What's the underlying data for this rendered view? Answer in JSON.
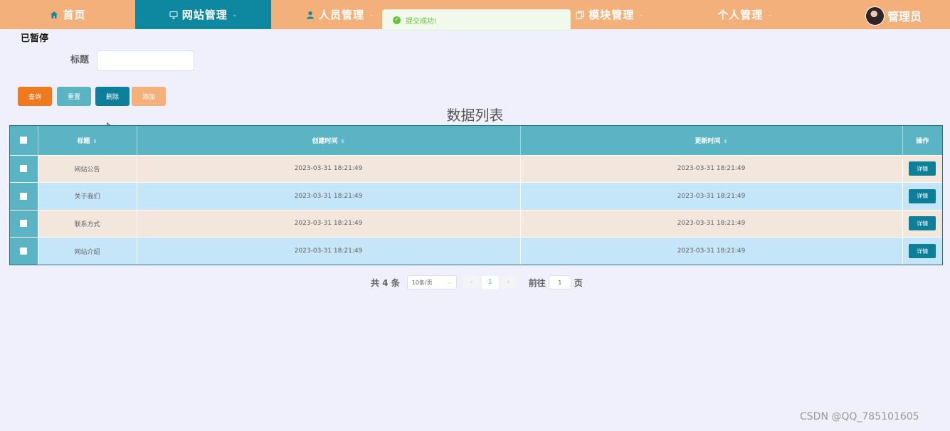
{
  "nav": {
    "items": [
      {
        "label": "首页",
        "icon": "home-icon",
        "active": false,
        "dropdown": false
      },
      {
        "label": "网站管理",
        "icon": "monitor-icon",
        "active": true,
        "dropdown": true
      },
      {
        "label": "人员管理",
        "icon": "user-icon",
        "active": false,
        "dropdown": true
      },
      {
        "label": "模块管理",
        "icon": "copy-icon",
        "active": false,
        "dropdown": true
      },
      {
        "label": "个人管理",
        "icon": "",
        "active": false,
        "dropdown": true
      }
    ],
    "user_name": "管理员",
    "caret": "⌄"
  },
  "toast": {
    "message": "提交成功!",
    "type": "success"
  },
  "paused_text": "已暂停",
  "search": {
    "label": "标题",
    "value": "",
    "placeholder": ""
  },
  "buttons": {
    "query": "查询",
    "reset": "重置",
    "delete": "删除",
    "add": "添加"
  },
  "table": {
    "title": "数据列表",
    "headers": {
      "title": "标题",
      "created": "创建时间",
      "updated": "更新时间",
      "op": "操作"
    },
    "sort_icon": "⇕",
    "rows": [
      {
        "title": "网站公告",
        "created": "2023-03-31 18:21:49",
        "updated": "2023-03-31 18:21:49"
      },
      {
        "title": "关于我们",
        "created": "2023-03-31 18:21:49",
        "updated": "2023-03-31 18:21:49"
      },
      {
        "title": "联系方式",
        "created": "2023-03-31 18:21:49",
        "updated": "2023-03-31 18:21:49"
      },
      {
        "title": "网站介绍",
        "created": "2023-03-31 18:21:49",
        "updated": "2023-03-31 18:21:49"
      }
    ],
    "detail_label": "详情"
  },
  "pagination": {
    "total_text": "共 4 条",
    "page_size": "10条/页",
    "current_page": "1",
    "goto_label": "前往",
    "goto_value": "1",
    "page_suffix": "页",
    "prev": "‹",
    "next": "›"
  },
  "watermark": "CSDN @QQ_785101605",
  "colors": {
    "nav_bg": "#f4b07a",
    "nav_active": "#0e87a0",
    "table_header": "#5ab4c4",
    "row_odd": "#f2e6dd",
    "row_even": "#c5e6f8",
    "success": "#67c23a"
  }
}
